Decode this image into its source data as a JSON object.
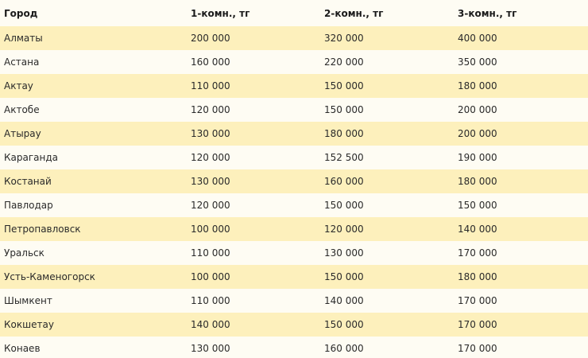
{
  "table": {
    "headers": [
      "Город",
      "1-комн., тг",
      "2-комн., тг",
      "3-комн., тг"
    ],
    "rows": [
      [
        "Алматы",
        "200 000",
        "320 000",
        "400 000"
      ],
      [
        "Астана",
        "160 000",
        "220 000",
        "350 000"
      ],
      [
        "Актау",
        "110 000",
        "150 000",
        "180 000"
      ],
      [
        "Актобе",
        "120 000",
        "150 000",
        "200 000"
      ],
      [
        "Атырау",
        "130 000",
        "180 000",
        "200 000"
      ],
      [
        "Караганда",
        "120 000",
        "152 500",
        "190 000"
      ],
      [
        "Костанай",
        "130 000",
        "160 000",
        "180 000"
      ],
      [
        "Павлодар",
        "120 000",
        "150 000",
        "150 000"
      ],
      [
        "Петропавловск",
        "100 000",
        "120 000",
        "140 000"
      ],
      [
        "Уральск",
        "110 000",
        "130 000",
        "170 000"
      ],
      [
        "Усть-Каменогорск",
        "100 000",
        "150 000",
        "180 000"
      ],
      [
        "Шымкент",
        "110 000",
        "140 000",
        "170 000"
      ],
      [
        "Кокшетау",
        "140 000",
        "150 000",
        "170 000"
      ],
      [
        "Конаев",
        "130 000",
        "160 000",
        "170 000"
      ]
    ]
  },
  "colors": {
    "row_highlight": "#fdf0bc",
    "row_plain": "#fefcf3"
  }
}
